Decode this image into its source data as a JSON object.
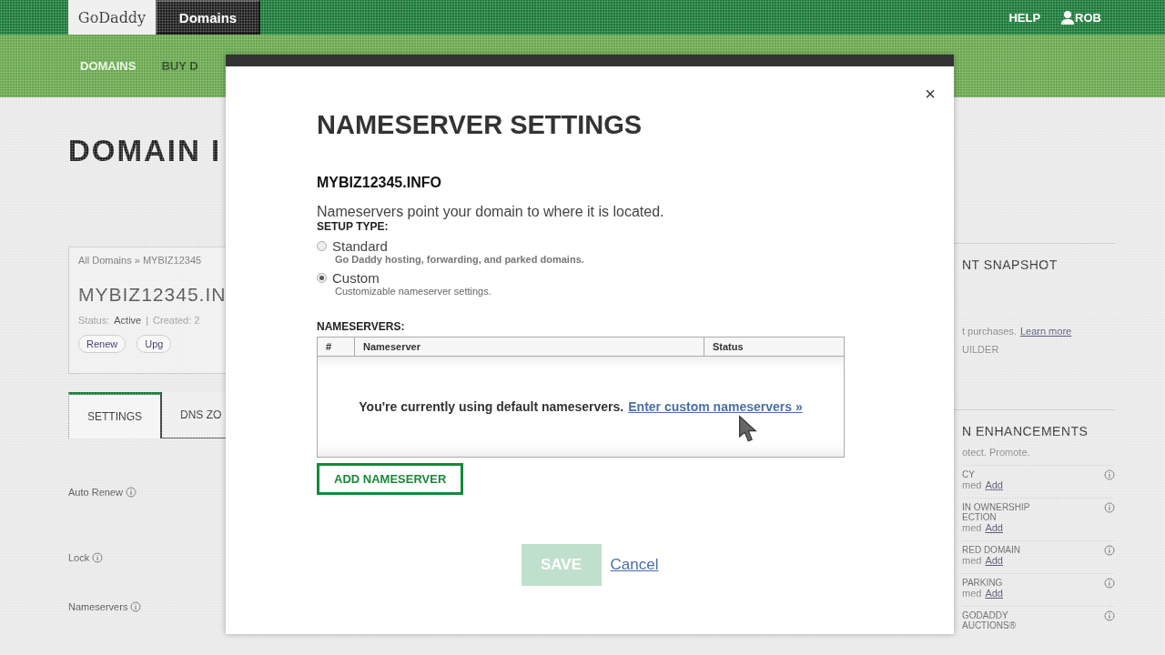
{
  "header": {
    "logo": "GoDaddy",
    "product": "Domains",
    "help": "HELP",
    "user": "ROB"
  },
  "nav": [
    {
      "label": "DOMAINS",
      "selected": true
    },
    {
      "label": "BUY D",
      "selected": false
    }
  ],
  "page": {
    "title": "DOMAIN I",
    "breadcrumb": "All Domains » MYBIZ12345",
    "domain": "MYBIZ12345.IN",
    "status_label": "Status:",
    "status": "Active",
    "separator": "|",
    "created": "Created: 2",
    "actions": [
      "Renew",
      "Upg"
    ],
    "tabs": [
      {
        "label": "SETTINGS",
        "selected": true
      },
      {
        "label": "DNS ZO",
        "selected": false
      }
    ],
    "settings": [
      "Auto Renew",
      "Lock",
      "Nameservers"
    ]
  },
  "sidebar": {
    "snapshot_title": "NT SNAPSHOT",
    "purchases_text": "t purchases.",
    "learn_more": "Learn more",
    "builder": "UILDER",
    "enhancements_title": "N ENHANCEMENTS",
    "enhancements_sub": "otect. Promote.",
    "items": [
      {
        "name": "CY",
        "status": "med",
        "action": "Add"
      },
      {
        "name": "IN OWNERSHIP ECTION",
        "status": "med",
        "action": "Add"
      },
      {
        "name": "RED DOMAIN",
        "status": "med",
        "action": "Add"
      },
      {
        "name": "PARKING",
        "status": "med",
        "action": "Add"
      },
      {
        "name": "GODADDY AUCTIONS®"
      }
    ]
  },
  "modal": {
    "close": "×",
    "title": "NAMESERVER SETTINGS",
    "domain": "MYBIZ12345.INFO",
    "description": "Nameservers point your domain to where it is located.",
    "setup_label": "SETUP TYPE:",
    "setup_types": [
      {
        "label": "Standard",
        "desc": "Go Daddy hosting, forwarding, and parked domains.",
        "selected": false
      },
      {
        "label": "Custom",
        "desc": "Customizable nameserver settings.",
        "selected": true
      }
    ],
    "nameservers_label": "NAMESERVERS:",
    "table": {
      "columns": [
        "#",
        "Nameserver",
        "Status"
      ],
      "message": "You're currently using default nameservers.",
      "link": "Enter custom nameservers »"
    },
    "add_button": "ADD NAMESERVER",
    "save": {
      "label": "SAVE",
      "disabled": true
    },
    "cancel": "Cancel"
  }
}
